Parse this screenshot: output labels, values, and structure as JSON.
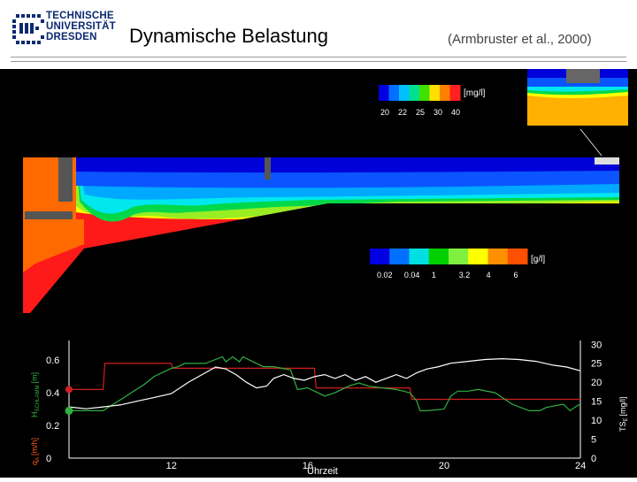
{
  "header": {
    "logo_lines": [
      "TECHNISCHE",
      "UNIVERSITÄT",
      "DRESDEN"
    ],
    "title": "Dynamische Belastung",
    "citation": "(Armbruster et al., 2000)"
  },
  "colors": {
    "scale": [
      "#0000d8",
      "#0a55ff",
      "#00a8ff",
      "#00e8ee",
      "#00d84a",
      "#99ee22",
      "#ffff00",
      "#ffb000",
      "#ff6a00",
      "#ff1a1a"
    ],
    "red_series": "#d02020",
    "green_series": "#30b040",
    "white_series": "#ffffff"
  },
  "legends": {
    "outlet": {
      "unit": "[mg/l]",
      "colors": [
        "#0000e0",
        "#0070ff",
        "#00c0ff",
        "#00e090",
        "#40e000",
        "#ffe000",
        "#ff8000",
        "#ff2020"
      ],
      "ticks": [
        "20",
        "22",
        "25",
        "30",
        "40"
      ]
    },
    "sludge": {
      "unit": "[g/l]",
      "colors": [
        "#0000e0",
        "#0070ff",
        "#00e0e0",
        "#00d000",
        "#80f040",
        "#ffff00",
        "#ff9000",
        "#ff5000"
      ],
      "ticks": [
        "0.02",
        "0.04",
        "1",
        "3.2",
        "4",
        "6"
      ]
    }
  },
  "chart_data": {
    "type": "line",
    "xlabel": "Uhrzeit",
    "xlim": [
      9,
      24
    ],
    "xticks": [
      "12",
      "16",
      "20",
      "24"
    ],
    "left_axis": {
      "label_top": "H",
      "label_top_sub": "SCHLAMM",
      "label_top_unit": "[m]",
      "label_bottom": "q",
      "label_bottom_sub": "A",
      "label_bottom_unit": "[m/h]",
      "ylim": [
        0,
        0.72
      ],
      "ticks": [
        "0",
        "0.2",
        "0.4",
        "0.6"
      ]
    },
    "right_axis": {
      "label": "TS",
      "label_sub": "E",
      "label_unit": "[mg/l]",
      "ylim": [
        0,
        31
      ],
      "ticks": [
        "0",
        "5",
        "10",
        "15",
        "20",
        "25",
        "30"
      ]
    },
    "series": [
      {
        "color": "#d02020",
        "axis": "left",
        "x": [
          9.0,
          10.0,
          10.05,
          12.0,
          12.05,
          16.2,
          16.25,
          19.0,
          19.05,
          24.0
        ],
        "y": [
          0.42,
          0.42,
          0.58,
          0.58,
          0.55,
          0.55,
          0.43,
          0.43,
          0.36,
          0.36
        ]
      },
      {
        "color": "#30b040",
        "axis": "left",
        "x": [
          9.0,
          10.0,
          10.3,
          10.6,
          10.9,
          11.2,
          11.5,
          12.0,
          12.2,
          12.4,
          13.0,
          13.5,
          13.6,
          13.8,
          14.0,
          14.1,
          14.3,
          14.5,
          14.7,
          15.0,
          15.5,
          15.7,
          16.0,
          16.3,
          16.5,
          16.8,
          17.0,
          17.2,
          17.5,
          17.8,
          18.2,
          18.6,
          19.0,
          19.2,
          19.3,
          19.5,
          20.0,
          20.2,
          20.4,
          20.7,
          21.0,
          21.5,
          22.0,
          22.5,
          22.8,
          23.0,
          23.5,
          23.7,
          23.9,
          24.0
        ],
        "y": [
          0.29,
          0.29,
          0.33,
          0.37,
          0.41,
          0.45,
          0.5,
          0.55,
          0.56,
          0.58,
          0.58,
          0.62,
          0.59,
          0.62,
          0.59,
          0.62,
          0.6,
          0.58,
          0.56,
          0.56,
          0.54,
          0.42,
          0.43,
          0.4,
          0.38,
          0.4,
          0.42,
          0.44,
          0.46,
          0.44,
          0.43,
          0.42,
          0.4,
          0.35,
          0.29,
          0.29,
          0.3,
          0.38,
          0.41,
          0.41,
          0.42,
          0.4,
          0.33,
          0.29,
          0.29,
          0.31,
          0.33,
          0.29,
          0.32,
          0.33
        ]
      },
      {
        "color": "#ffffff",
        "axis": "right",
        "x": [
          9.0,
          9.5,
          10.0,
          10.5,
          11.0,
          11.5,
          12.0,
          12.5,
          13.0,
          13.3,
          13.6,
          13.9,
          14.2,
          14.5,
          14.8,
          15.0,
          15.3,
          15.6,
          15.9,
          16.2,
          16.5,
          16.8,
          17.1,
          17.4,
          17.7,
          18.0,
          18.3,
          18.6,
          18.9,
          19.2,
          19.5,
          19.8,
          20.2,
          20.7,
          21.2,
          21.7,
          22.2,
          22.7,
          23.2,
          23.6,
          24.0
        ],
        "y": [
          13.5,
          13.0,
          13.5,
          14.0,
          15.0,
          16.0,
          17.0,
          20.0,
          22.5,
          24.0,
          23.5,
          22.0,
          20.0,
          18.5,
          19.0,
          21.0,
          22.0,
          21.0,
          20.5,
          21.5,
          22.0,
          21.0,
          22.0,
          20.5,
          21.5,
          20.0,
          21.0,
          22.0,
          21.0,
          22.5,
          23.5,
          24.0,
          25.0,
          25.5,
          26.0,
          26.2,
          26.0,
          25.5,
          24.5,
          24.0,
          23.0
        ]
      }
    ]
  }
}
